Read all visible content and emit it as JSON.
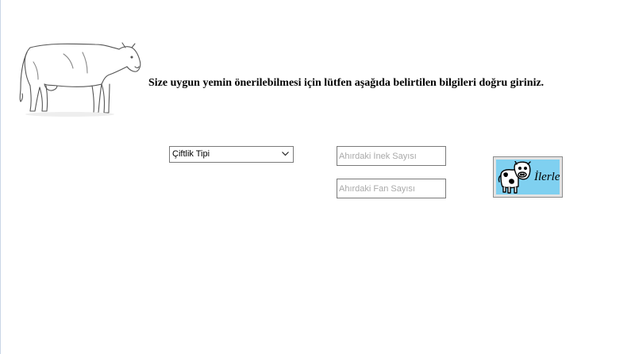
{
  "header": {
    "instruction": "Size uygun yemin önerilebilmesi için lütfen aşağıda belirtilen bilgileri doğru giriniz."
  },
  "form": {
    "farm_type": {
      "selected": "Çiftlik Tipi"
    },
    "cow_count": {
      "placeholder": "Ahırdaki İnek Sayısı",
      "value": ""
    },
    "fan_count": {
      "placeholder": "Ahırdaki Fan Sayısı",
      "value": ""
    },
    "next_button": {
      "label": "İlerle",
      "icon": "cartoon-cow-icon",
      "color": "#7fd0f0"
    }
  },
  "decor": {
    "illustration": "cow-sketch"
  }
}
